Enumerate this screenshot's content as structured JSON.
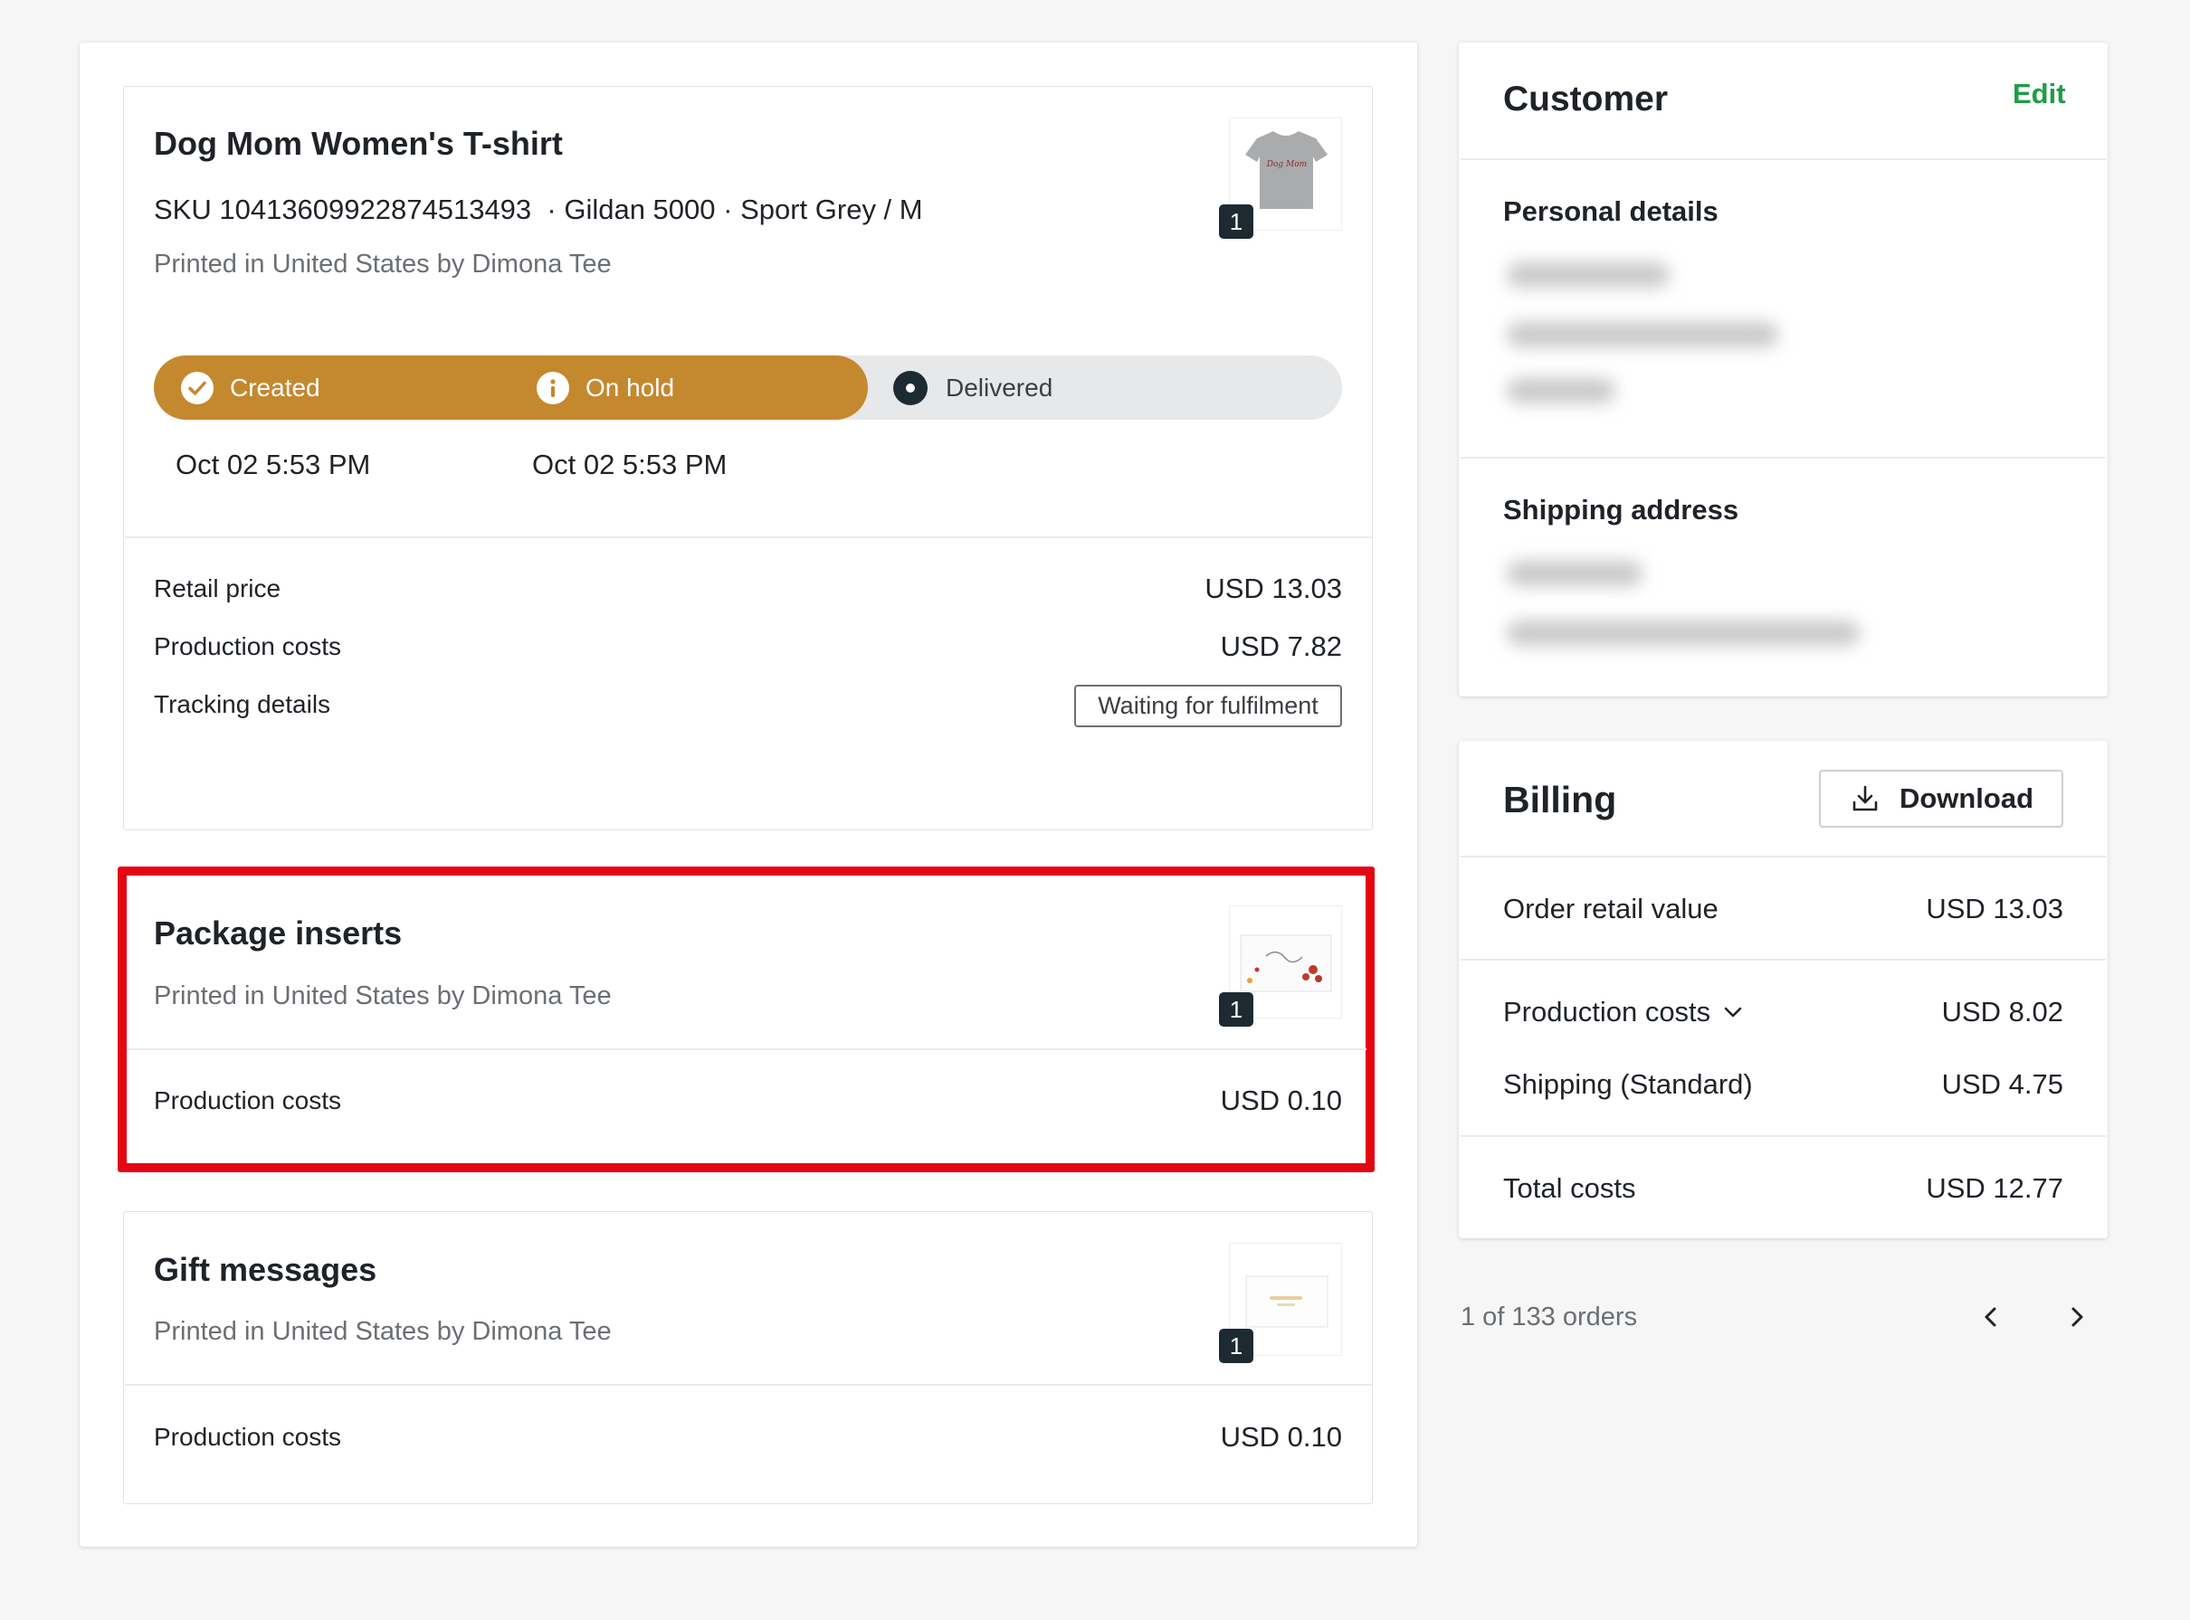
{
  "product": {
    "title": "Dog Mom Women's T-shirt",
    "sku_line": "SKU 10413609922874513493  · Gildan 5000 · Sport Grey / M",
    "printed_by": "Printed in United States by Dimona Tee",
    "thumbnail_text": "Dog Mom",
    "quantity": "1",
    "status_steps": [
      {
        "label": "Created",
        "date": "Oct 02 5:53 PM",
        "icon": "check-icon",
        "state": "done"
      },
      {
        "label": "On hold",
        "date": "Oct 02 5:53 PM",
        "icon": "info-icon",
        "state": "active"
      },
      {
        "label": "Delivered",
        "date": "",
        "icon": "dot-icon",
        "state": "pending"
      }
    ],
    "rows": {
      "retail_label": "Retail price",
      "retail_value": "USD 13.03",
      "production_label": "Production costs",
      "production_value": "USD 7.82",
      "tracking_label": "Tracking details",
      "tracking_value": "Waiting for fulfilment"
    }
  },
  "package_inserts": {
    "title": "Package inserts",
    "printed_by": "Printed in United States by Dimona Tee",
    "quantity": "1",
    "production_label": "Production costs",
    "production_value": "USD 0.10"
  },
  "gift_messages": {
    "title": "Gift messages",
    "printed_by": "Printed in United States by Dimona Tee",
    "quantity": "1",
    "production_label": "Production costs",
    "production_value": "USD 0.10"
  },
  "customer": {
    "title": "Customer",
    "edit_label": "Edit",
    "personal_heading": "Personal details",
    "shipping_heading": "Shipping address"
  },
  "billing": {
    "title": "Billing",
    "download_label": "Download",
    "order_retail_label": "Order retail value",
    "order_retail_value": "USD 13.03",
    "production_label": "Production costs",
    "production_value": "USD 8.02",
    "shipping_label": "Shipping (Standard)",
    "shipping_value": "USD 4.75",
    "total_label": "Total costs",
    "total_value": "USD 12.77"
  },
  "pagination": {
    "text": "1 of 133 orders"
  },
  "colors": {
    "status_accent": "#c4882f",
    "highlight_border": "#e30613",
    "edit_link": "#1f9d46",
    "quantity_badge": "#1e2a32"
  }
}
